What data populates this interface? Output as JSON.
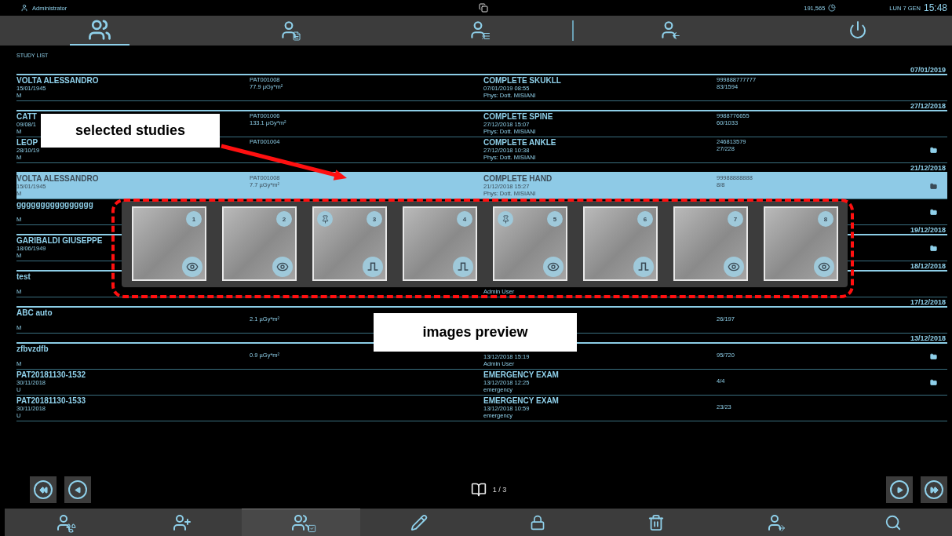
{
  "status_bar": {
    "user": "Administrator",
    "counter": "191,565",
    "date": "LUN 7 GEN",
    "time": "15:48"
  },
  "nav_tabs": [
    {
      "selected": true
    },
    {
      "selected": false
    },
    {
      "selected": false
    },
    {
      "selected": false
    },
    {
      "selected": false
    }
  ],
  "list_title": "STUDY LIST",
  "groups": [
    {
      "date": "07/01/2019",
      "studies": [
        {
          "selected": false,
          "stored": false,
          "name": "VOLTA ALESSANDRO",
          "birth_date": "15/01/1945",
          "sex": "M",
          "patient_id": "PAT001008",
          "dose": "77.9 µGy*m²",
          "exam": "COMPLETE SKUKLL",
          "exam_time": "07/01/2019 08:55",
          "operator": "Phys: Dott. MISIANI",
          "accession": "999888777777",
          "images": "83/1594"
        }
      ]
    },
    {
      "date": "27/12/2018",
      "studies": [
        {
          "selected": false,
          "stored": false,
          "name": "CATT",
          "birth_date": "09/08/1",
          "sex": "M",
          "patient_id": "PAT001006",
          "dose": "133.1 µGy*m²",
          "exam": "COMPLETE SPINE",
          "exam_time": "27/12/2018 15:07",
          "operator": "Phys: Dott. MISIANI",
          "accession": "9988776655",
          "images": "60/1033"
        },
        {
          "selected": false,
          "stored": true,
          "name": "LEOP",
          "birth_date": "28/10/19",
          "sex": "M",
          "patient_id": "PAT001004",
          "exam": "COMPLETE ANKLE",
          "exam_time": "27/12/2018 10:38",
          "operator": "Phys: Dott. MISIANI",
          "accession": "246813579",
          "images": "27/228"
        }
      ]
    },
    {
      "date": "21/12/2018",
      "studies": [
        {
          "selected": true,
          "stored": true,
          "name": "VOLTA ALESSANDRO",
          "birth_date": "15/01/1945",
          "sex": "M",
          "patient_id": "PAT001008",
          "dose": "7.7 µGy*m²",
          "exam": "COMPLETE HAND",
          "exam_time": "21/12/2018 15:27",
          "operator": "Phys: Dott. MISIANI",
          "accession": "99988888888",
          "images": "8/8"
        },
        {
          "selected": false,
          "stored": true,
          "name": "gggggggggggggggg",
          "sex": "M"
        }
      ]
    },
    {
      "date": "19/12/2018",
      "studies": [
        {
          "selected": false,
          "stored": true,
          "name": "GARIBALDI GIUSEPPE",
          "birth_date": "18/06/1949",
          "sex": "M"
        }
      ]
    },
    {
      "date": "18/12/2018",
      "studies": [
        {
          "selected": false,
          "stored": false,
          "name": "test",
          "sex": "M",
          "operator": "Admin User"
        }
      ]
    },
    {
      "date": "17/12/2018",
      "studies": [
        {
          "selected": false,
          "stored": false,
          "name": "ABC auto",
          "sex": "M",
          "dose": "2.1 µGy*m²",
          "images": "26/197"
        }
      ]
    },
    {
      "date": "13/12/2018",
      "studies": [
        {
          "selected": false,
          "stored": true,
          "name": "zfbvzdfb",
          "sex": "M",
          "dose": "0.9 µGy*m²",
          "exam_time": "13/12/2018 15:19",
          "operator": "Admin User",
          "images": "95/720"
        },
        {
          "selected": false,
          "stored": true,
          "name": "PAT20181130-1532",
          "birth_date": "30/11/2018",
          "sex": "U",
          "exam": "EMERGENCY EXAM",
          "exam_time": "13/12/2018 12:25",
          "operator": "emergency",
          "images": "4/4"
        },
        {
          "selected": false,
          "stored": false,
          "name": "PAT20181130-1533",
          "birth_date": "30/11/2018",
          "sex": "U",
          "exam": "EMERGENCY EXAM",
          "exam_time": "13/12/2018 10:59",
          "operator": "emergency",
          "images": "23/23"
        }
      ]
    }
  ],
  "preview": {
    "thumbnails": [
      {
        "number": "1",
        "pinned": false,
        "kind": "eye"
      },
      {
        "number": "2",
        "pinned": false,
        "kind": "eye"
      },
      {
        "number": "3",
        "pinned": true,
        "kind": "pulse"
      },
      {
        "number": "4",
        "pinned": false,
        "kind": "pulse"
      },
      {
        "number": "5",
        "pinned": true,
        "kind": "eye"
      },
      {
        "number": "6",
        "pinned": false,
        "kind": "pulse"
      },
      {
        "number": "7",
        "pinned": false,
        "kind": "eye"
      },
      {
        "number": "8",
        "pinned": false,
        "kind": "eye"
      }
    ]
  },
  "pagination": {
    "page": "1 / 3"
  },
  "toolbar": [
    {
      "selected": false
    },
    {
      "selected": false
    },
    {
      "selected": true
    },
    {
      "selected": false
    },
    {
      "selected": false
    },
    {
      "selected": false
    },
    {
      "selected": false
    },
    {
      "selected": false
    }
  ],
  "annotations": [
    {
      "kind": "callout",
      "text": "selected studies"
    },
    {
      "kind": "arrow"
    },
    {
      "kind": "outline"
    },
    {
      "kind": "callout",
      "text": "images preview"
    }
  ]
}
